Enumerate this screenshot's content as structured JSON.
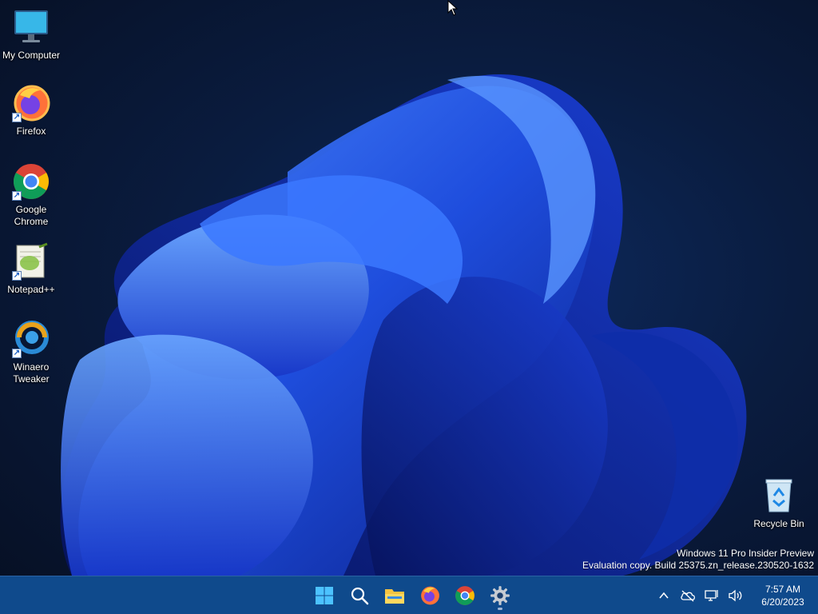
{
  "desktop": {
    "icons": [
      {
        "label": "My Computer",
        "icon": "monitor-icon"
      },
      {
        "label": "Firefox",
        "icon": "firefox-icon"
      },
      {
        "label": "Google Chrome",
        "icon": "chrome-icon"
      },
      {
        "label": "Notepad++",
        "icon": "notepadpp-icon"
      },
      {
        "label": "Winaero Tweaker",
        "icon": "winaero-icon"
      },
      {
        "label": "Recycle Bin",
        "icon": "recycle-bin-icon"
      }
    ],
    "watermark": {
      "line1": "Windows 11 Pro Insider Preview",
      "line2": "Evaluation copy. Build 25375.zn_release.230520-1632"
    }
  },
  "taskbar": {
    "apps": [
      "start-icon",
      "search-icon",
      "file-explorer-icon",
      "firefox-icon",
      "chrome-icon",
      "settings-icon"
    ],
    "clock": {
      "time": "7:57 AM",
      "date": "6/20/2023"
    },
    "tray": [
      "chevron-up-icon",
      "onedrive-icon",
      "network-icon",
      "volume-icon"
    ],
    "colors": {
      "bar": "#0f4a8c",
      "accent": "#1e6fff"
    }
  }
}
